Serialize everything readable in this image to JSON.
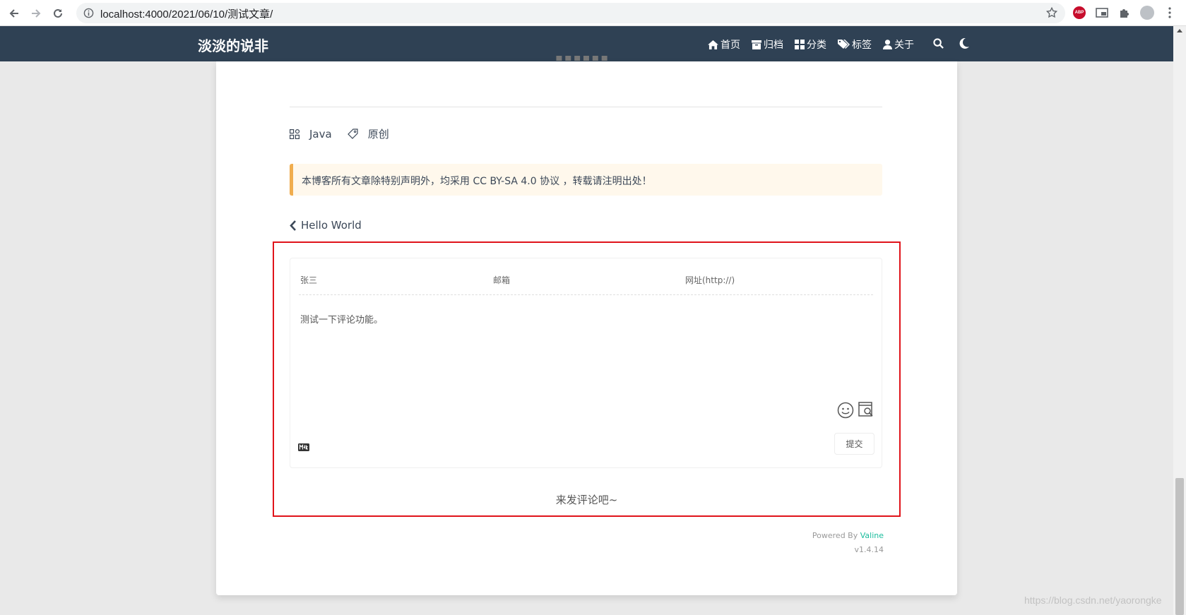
{
  "browser": {
    "url": "localhost:4000/2021/06/10/测试文章/",
    "extensions": [
      "abp-icon",
      "cast-icon",
      "puzzle-icon",
      "profile-icon"
    ]
  },
  "header": {
    "site_title": "淡淡的说非",
    "menu": [
      {
        "label": "首页",
        "icon": "home-icon"
      },
      {
        "label": "归档",
        "icon": "archive-icon"
      },
      {
        "label": "分类",
        "icon": "category-icon"
      },
      {
        "label": "标签",
        "icon": "tag-icon"
      },
      {
        "label": "关于",
        "icon": "user-icon"
      }
    ],
    "colors": {
      "bg": "#2f4154",
      "text": "#ffffff"
    }
  },
  "post": {
    "category": "Java",
    "tag": "原创",
    "license_notice": "本博客所有文章除特别声明外，均采用 CC BY-SA 4.0 协议 ，转载请注明出处！",
    "prev_post": "Hello World"
  },
  "comments": {
    "nick_value": "张三",
    "mail_placeholder": "邮箱",
    "link_placeholder": "网址(http://)",
    "content": "测试一下评论功能。",
    "submit_label": "提交",
    "md_badge": "M↓",
    "empty_text": "来发评论吧~",
    "powered_prefix": "Powered By",
    "powered_brand": "Valine",
    "version": "v1.4.14",
    "highlight_color": "#e0131a"
  },
  "watermark": "https://blog.csdn.net/yaorongke"
}
